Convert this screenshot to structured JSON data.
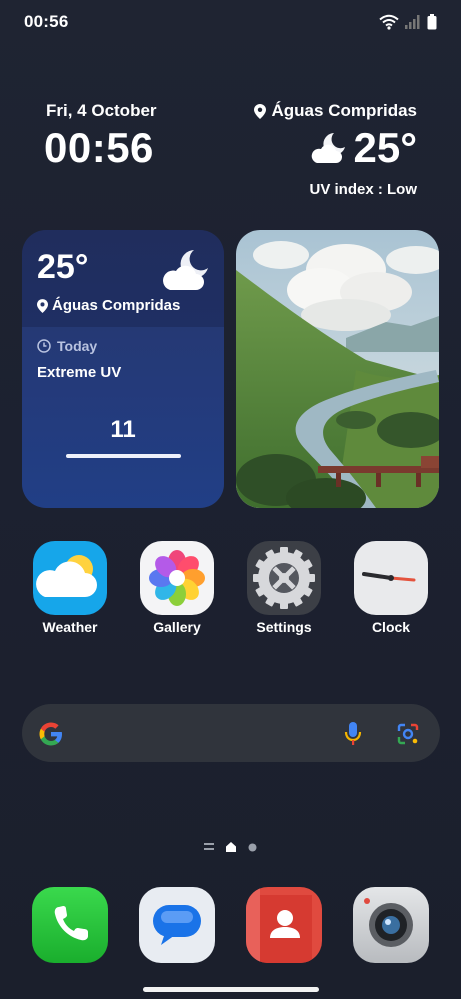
{
  "status_bar": {
    "time": "00:56",
    "icons": [
      "wifi-icon",
      "signal-icon",
      "battery-icon"
    ]
  },
  "clock_widget": {
    "date": "Fri, 4 October",
    "time": "00:56"
  },
  "header_weather": {
    "location": "Águas Compridas",
    "temperature": "25°",
    "uv_index": "UV index : Low",
    "condition_icon": "partly-cloudy-night-icon"
  },
  "weather_widget": {
    "temperature": "25°",
    "location": "Águas Compridas",
    "period": "Today",
    "uv_label": "Extreme UV",
    "uv_value": "11",
    "condition_icon": "partly-cloudy-night-icon"
  },
  "photo_widget": {
    "icon": "landscape-photo-icon"
  },
  "apps": [
    {
      "label": "Weather",
      "icon": "weather-app-icon"
    },
    {
      "label": "Gallery",
      "icon": "gallery-app-icon"
    },
    {
      "label": "Settings",
      "icon": "settings-app-icon"
    },
    {
      "label": "Clock",
      "icon": "clock-app-icon"
    }
  ],
  "search_bar": {
    "icons": [
      "google-g-icon",
      "microphone-icon",
      "google-lens-icon"
    ]
  },
  "page_indicator": {
    "pages": 2,
    "current": 1
  },
  "dock": [
    {
      "name": "phone",
      "icon": "phone-app-icon",
      "color": "#27c23d"
    },
    {
      "name": "messages",
      "icon": "messages-app-icon",
      "color": "#e8ecf2"
    },
    {
      "name": "contacts",
      "icon": "contacts-app-icon",
      "color": "#e04a3f"
    },
    {
      "name": "camera",
      "icon": "camera-app-icon",
      "color": "#cfd2d6"
    }
  ],
  "colors": {
    "background": "#1d2230",
    "weather_widget": "#243a7a",
    "search_bar": "#30343c"
  }
}
